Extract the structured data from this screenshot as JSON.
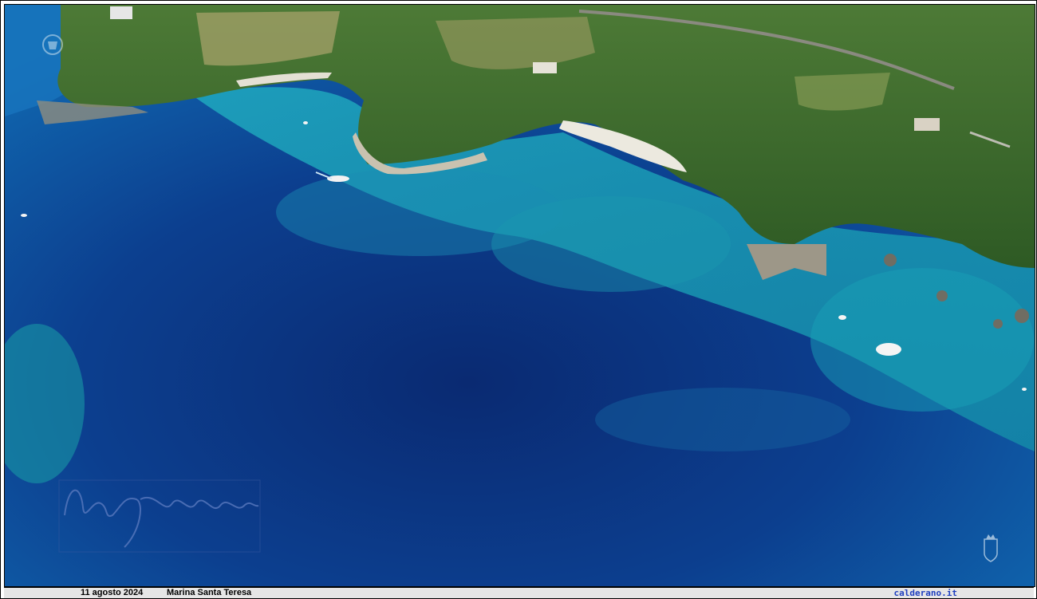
{
  "photo": {
    "subject": "aerial-coastline",
    "colors": {
      "deep_sea": "#0a2f7a",
      "mid_sea": "#0f5aa8",
      "shallow_sea": "#19a3b8",
      "vegetation": "#3f6a2a",
      "beach": "#e8e6dc"
    }
  },
  "caption": {
    "date": "11 agosto 2024",
    "place": "Marina Santa Teresa",
    "site": "calderano.it"
  },
  "icons": {
    "top_left": "emblem-icon",
    "bottom_right": "crest-icon",
    "signature": "signature-icon"
  }
}
